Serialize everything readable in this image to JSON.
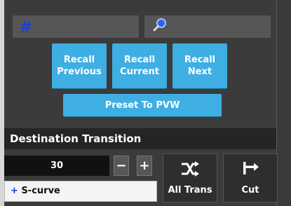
{
  "inputs": {
    "hash_symbol": "#",
    "search_icon": "magnifier-icon"
  },
  "recall": {
    "previous": [
      "Recall",
      "Previous"
    ],
    "current": [
      "Recall",
      "Current"
    ],
    "next": [
      "Recall",
      "Next"
    ]
  },
  "preset_label": "Preset To PVW",
  "section_title": "Destination Transition",
  "transition": {
    "rate": "30",
    "minus": "−",
    "plus": "+",
    "curve_prefix": "+",
    "curve_name": "S-curve"
  },
  "tiles": {
    "all_trans": "All Trans",
    "cut": "Cut"
  },
  "colors": {
    "accent": "#3faee2",
    "hash": "#1b3fd6",
    "panel": "#3b3b3b"
  }
}
